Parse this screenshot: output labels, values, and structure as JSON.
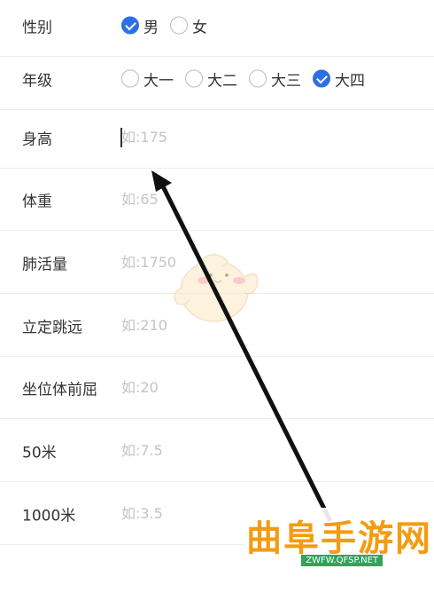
{
  "form": {
    "gender": {
      "label": "性别",
      "options": [
        {
          "label": "男",
          "checked": true
        },
        {
          "label": "女",
          "checked": false
        }
      ]
    },
    "grade": {
      "label": "年级",
      "options": [
        {
          "label": "大一",
          "checked": false
        },
        {
          "label": "大二",
          "checked": false
        },
        {
          "label": "大三",
          "checked": false
        },
        {
          "label": "大四",
          "checked": true
        }
      ]
    },
    "height": {
      "label": "身高",
      "placeholder": "如:175",
      "value": ""
    },
    "weight": {
      "label": "体重",
      "placeholder": "如:65",
      "value": ""
    },
    "lung": {
      "label": "肺活量",
      "placeholder": "如:1750",
      "value": ""
    },
    "jump": {
      "label": "立定跳远",
      "placeholder": "如:210",
      "value": ""
    },
    "sit_reach": {
      "label": "坐位体前屈",
      "placeholder": "如:20",
      "value": ""
    },
    "run50": {
      "label": "50米",
      "placeholder": "如:7.5",
      "value": ""
    },
    "run1000": {
      "label": "1000米",
      "placeholder": "如:3.5",
      "value": ""
    }
  },
  "watermark": {
    "title": "曲阜手游网",
    "url": "ZWFW.QFSP.NET"
  },
  "colors": {
    "accent": "#2f6fe5",
    "label": "#333333",
    "placeholder": "#c4c4c4",
    "divider": "#ececec",
    "watermark_orange": "#f39c12",
    "watermark_green": "#2fa55c"
  }
}
